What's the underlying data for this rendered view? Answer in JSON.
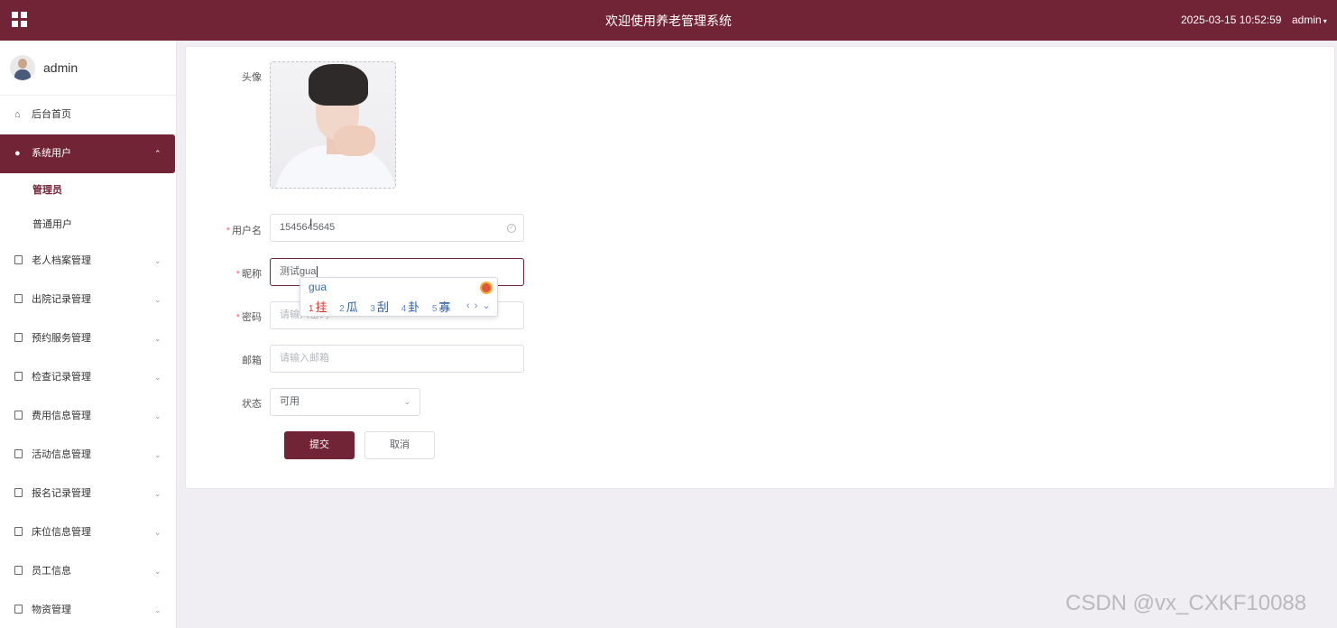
{
  "header": {
    "title": "欢迎使用养老管理系统",
    "datetime": "2025-03-15 10:52:59",
    "user": "admin",
    "user_caret": "▾"
  },
  "sidebar": {
    "username": "admin",
    "items": [
      {
        "label": "后台首页",
        "icon": "home-icon"
      },
      {
        "label": "系统用户",
        "icon": "user-icon",
        "expanded": true,
        "children": [
          {
            "label": "管理员",
            "current": true
          },
          {
            "label": "普通用户"
          }
        ]
      },
      {
        "label": "老人档案管理",
        "icon": "doc-icon"
      },
      {
        "label": "出院记录管理",
        "icon": "doc-icon"
      },
      {
        "label": "预约服务管理",
        "icon": "doc-icon"
      },
      {
        "label": "检查记录管理",
        "icon": "doc-icon"
      },
      {
        "label": "费用信息管理",
        "icon": "doc-icon"
      },
      {
        "label": "活动信息管理",
        "icon": "doc-icon"
      },
      {
        "label": "报名记录管理",
        "icon": "doc-icon"
      },
      {
        "label": "床位信息管理",
        "icon": "doc-icon"
      },
      {
        "label": "员工信息",
        "icon": "doc-icon"
      },
      {
        "label": "物资管理",
        "icon": "doc-icon"
      }
    ]
  },
  "form": {
    "avatar_label": "头像",
    "username_label": "用户名",
    "username_value": "1545645645",
    "nickname_label": "昵称",
    "nickname_value": "测试gua",
    "password_label": "密码",
    "password_placeholder": "请输入密码",
    "email_label": "邮箱",
    "email_placeholder": "请输入邮箱",
    "status_label": "状态",
    "status_value": "可用",
    "required_mark": "*",
    "submit_label": "提交",
    "cancel_label": "取消"
  },
  "ime": {
    "pinyin": "gua",
    "candidates": [
      {
        "num": "1",
        "text": "挂"
      },
      {
        "num": "2",
        "text": "瓜"
      },
      {
        "num": "3",
        "text": "刮"
      },
      {
        "num": "4",
        "text": "卦"
      },
      {
        "num": "5",
        "text": "寡"
      }
    ],
    "nav": "‹ › ⌄"
  },
  "watermark": "CSDN @vx_CXKF10088",
  "colors": {
    "brand": "#722437",
    "required": "#f56c6c"
  }
}
